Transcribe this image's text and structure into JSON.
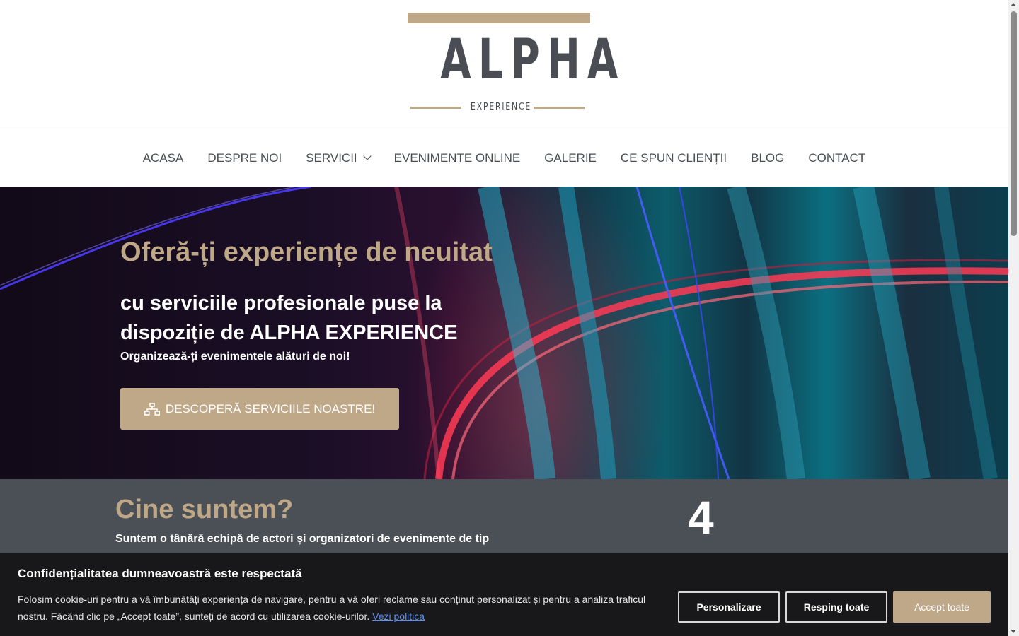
{
  "logo": {
    "title": "ALPHA",
    "subtitle": "EXPERIENCE"
  },
  "nav": {
    "items": [
      {
        "label": "ACASA"
      },
      {
        "label": "DESPRE NOI"
      },
      {
        "label": "SERVICII"
      },
      {
        "label": "EVENIMENTE ONLINE"
      },
      {
        "label": "GALERIE"
      },
      {
        "label": "CE SPUN CLIENȚII"
      },
      {
        "label": "BLOG"
      },
      {
        "label": "CONTACT"
      }
    ]
  },
  "hero": {
    "title": "Oferă-ți experiențe de neuitat",
    "subtitle": "cu serviciile profesionale puse la dispoziție de ALPHA EXPERIENCE",
    "tagline": "Organizează-ți evenimentele alături de noi!",
    "button_label": "DESCOPERĂ SERVICIILE NOASTRE!",
    "button_icon": "sitemap-icon"
  },
  "about": {
    "title": "Cine suntem?",
    "text": "Suntem o tânără echipă de actori și organizatori de evenimente de tip",
    "counter": "4"
  },
  "cookie": {
    "title": "Confidențialitatea dumneavoastră este respectată",
    "text": "Folosim cookie-uri pentru a vă îmbunătăți experiența de navigare, pentru a vă oferi reclame sau conținut personalizat și pentru a analiza traficul nostru. Făcând clic pe „Accept toate”, sunteți de acord cu utilizarea cookie-urilor.",
    "link_label": "Vezi politica",
    "customize_label": "Personalizare",
    "reject_label": "Resping toate",
    "accept_label": "Accept toate"
  },
  "colors": {
    "accent": "#bfa888",
    "dark": "#4a4e54",
    "section_bg": "#4b4f56",
    "cookie_bg": "#18181a"
  }
}
